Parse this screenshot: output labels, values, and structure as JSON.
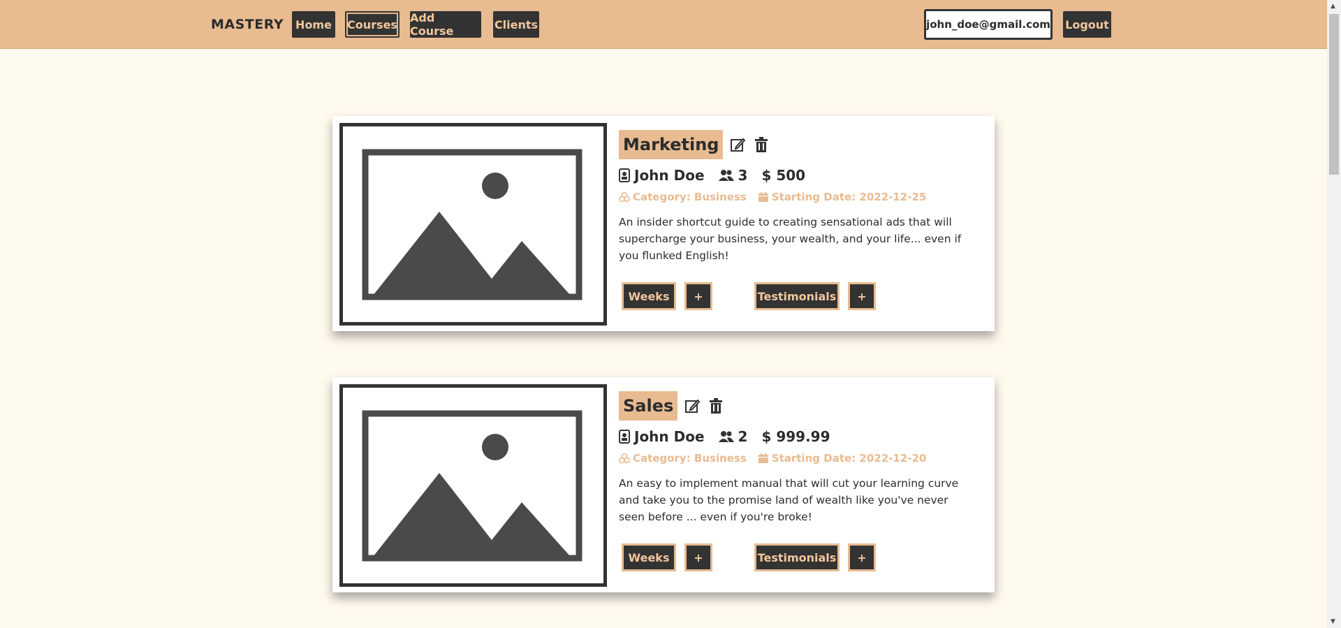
{
  "navbar": {
    "brand": "MASTERY",
    "links": [
      {
        "label": "Home"
      },
      {
        "label": "Courses"
      },
      {
        "label": "Add Course"
      },
      {
        "label": "Clients"
      }
    ],
    "user_email": "john_doe@gmail.com",
    "logout_label": "Logout"
  },
  "colors": {
    "accent": "#e8bb91",
    "dark": "#333333",
    "background": "#fff9ee"
  },
  "courses": [
    {
      "title": "Marketing",
      "instructor": "John Doe",
      "students": "3",
      "price": "$ 500",
      "category": "Category: Business",
      "start_date": "Starting Date: 2022-12-25",
      "description": "An insider shortcut guide to creating sensational ads that will supercharge your business, your wealth, and your life... even if you flunked English!",
      "weeks_label": "Weeks",
      "add_week_label": "+",
      "testimonials_label": "Testimonials",
      "add_testimonial_label": "+"
    },
    {
      "title": "Sales",
      "instructor": "John Doe",
      "students": "2",
      "price": "$ 999.99",
      "category": "Category: Business",
      "start_date": "Starting Date: 2022-12-20",
      "description": "An easy to implement manual that will cut your learning curve and take you to the promise land of wealth like you've never seen before ... even if you're broke!",
      "weeks_label": "Weeks",
      "add_week_label": "+",
      "testimonials_label": "Testimonials",
      "add_testimonial_label": "+"
    }
  ]
}
